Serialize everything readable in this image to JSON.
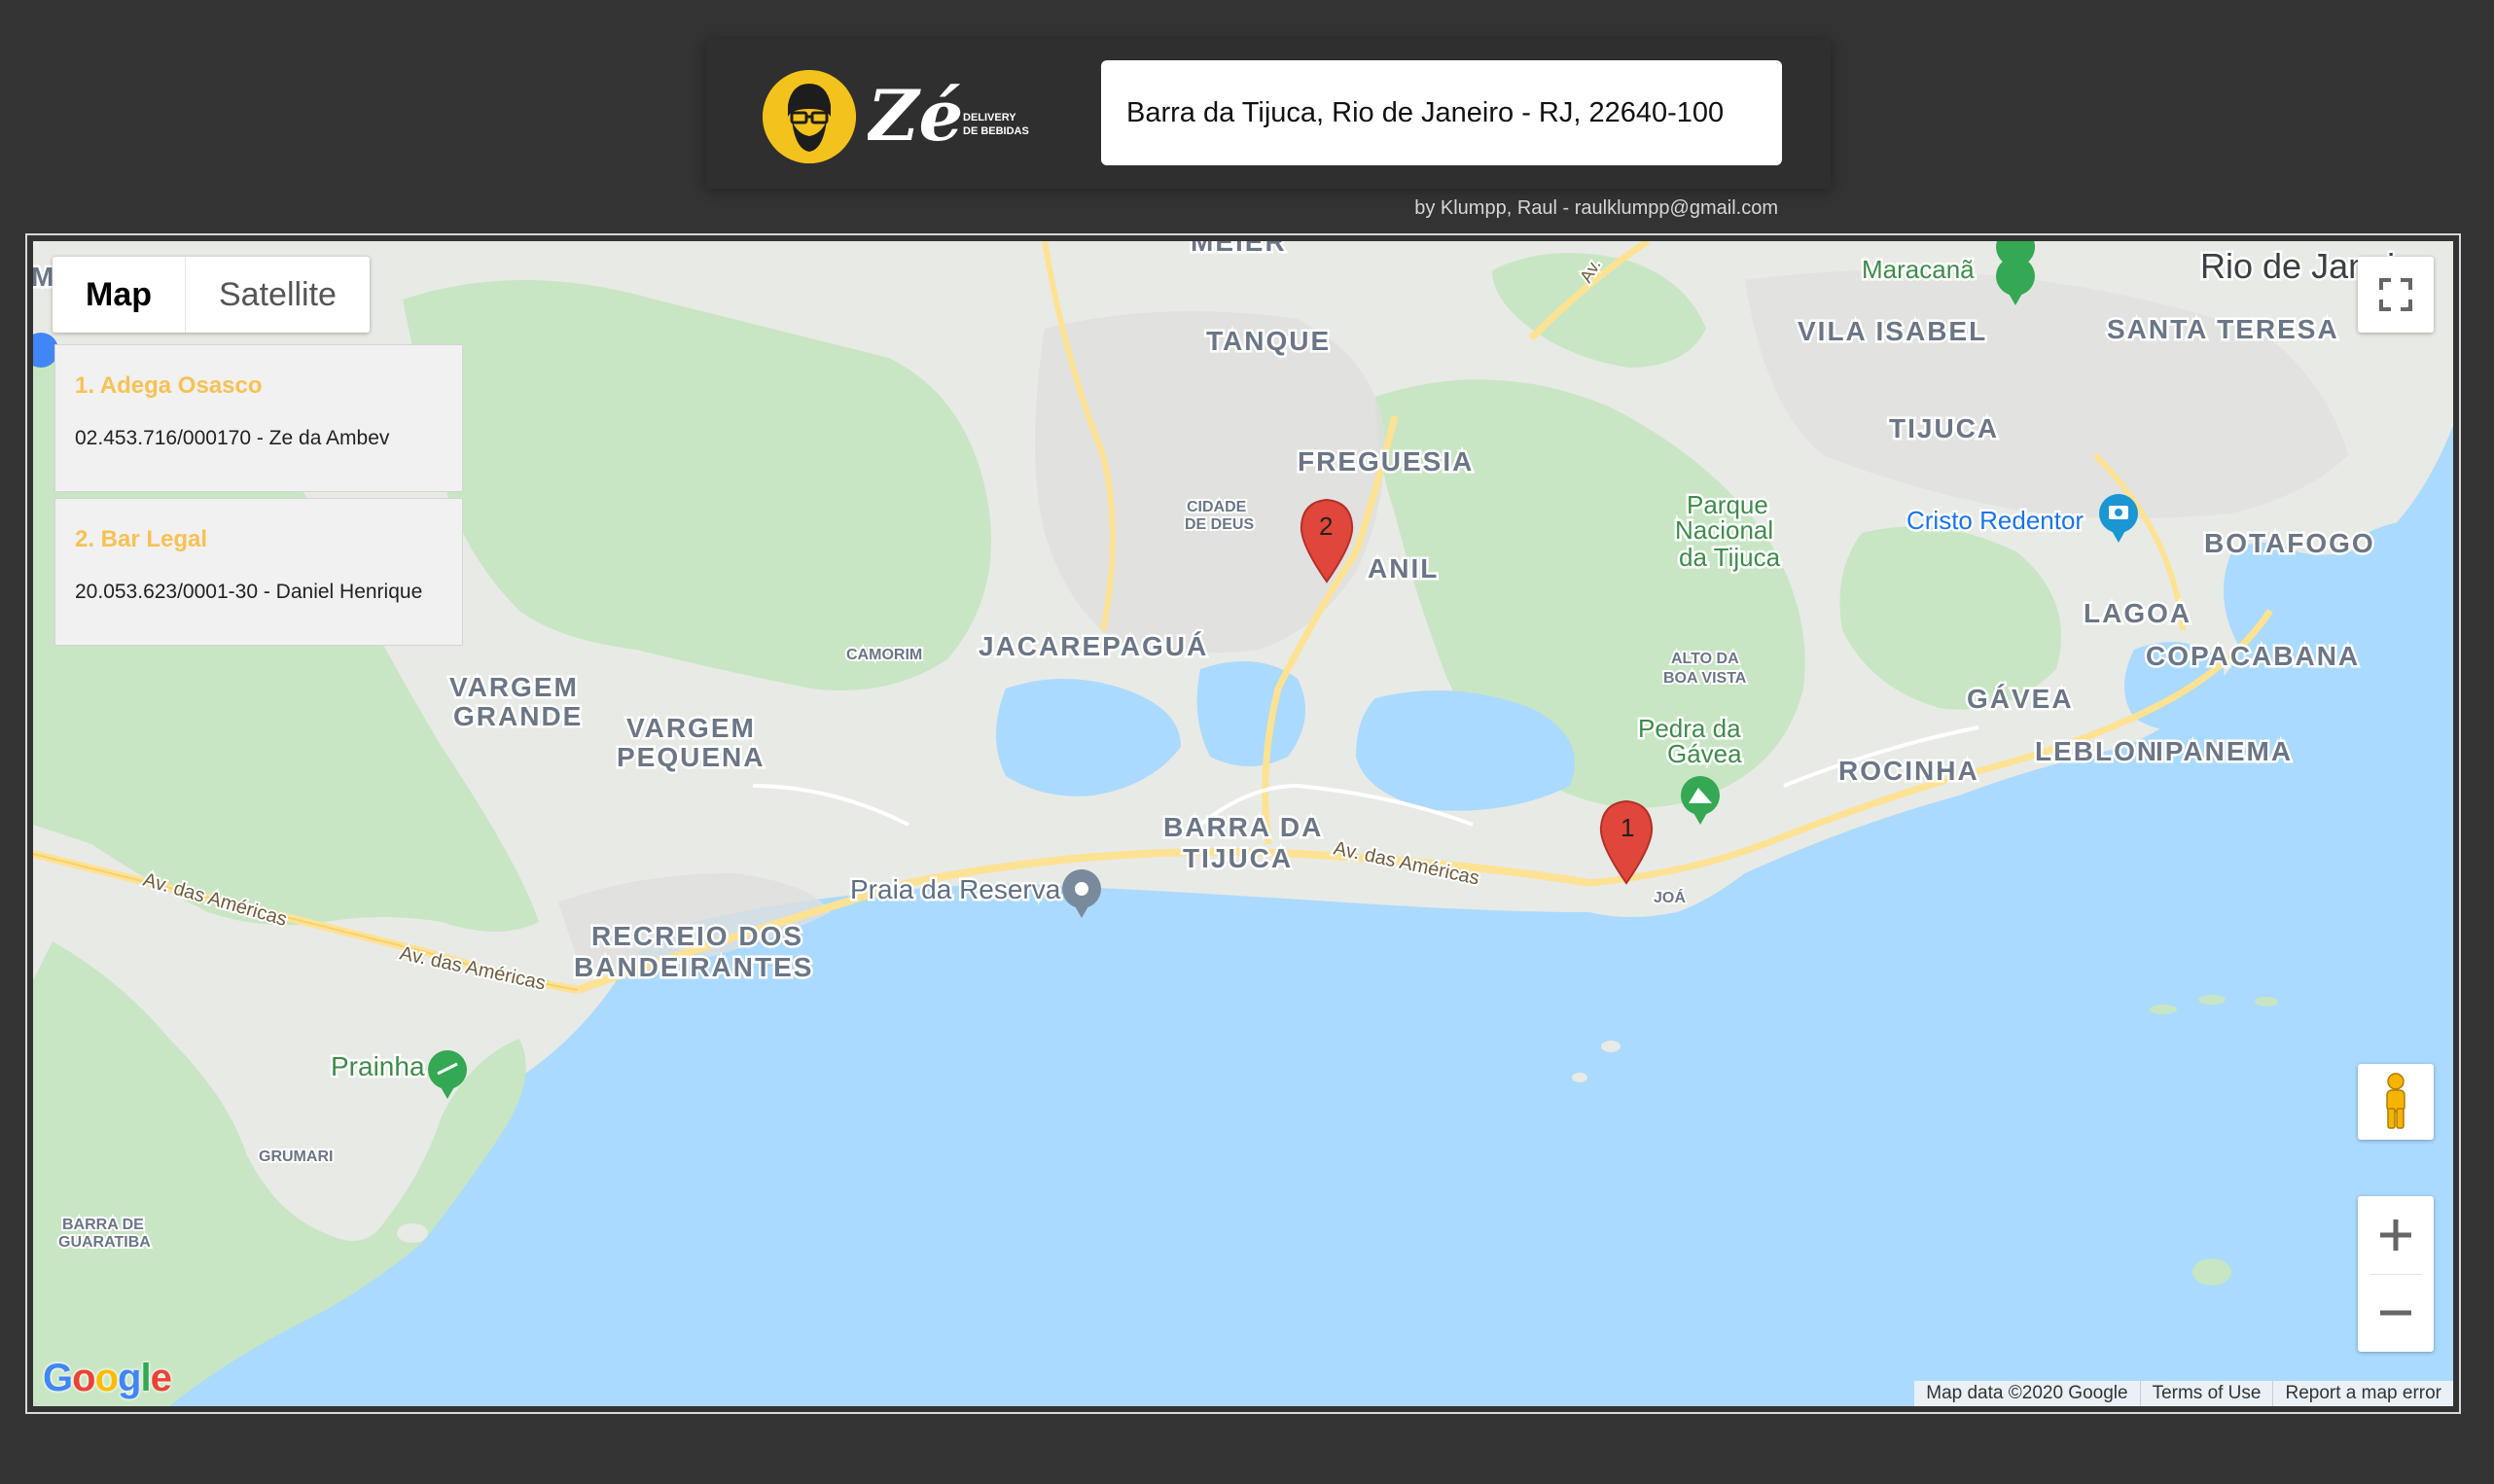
{
  "header": {
    "logo_text": "Zé",
    "logo_tagline_1": "DELIVERY",
    "logo_tagline_2": "DE BEBIDAS",
    "address_value": "Barra da Tijuca, Rio de Janeiro - RJ, 22640-100",
    "credit": "by Klumpp, Raul - raulklumpp@gmail.com"
  },
  "map": {
    "type_tabs": [
      {
        "label": "Map",
        "active": true
      },
      {
        "label": "Satellite",
        "active": false
      }
    ],
    "stores": [
      {
        "name": "1. Adega Osasco",
        "info": "02.453.716/000170 - Ze da Ambev"
      },
      {
        "name": "2. Bar Legal",
        "info": "20.053.623/0001-30 - Daniel Henrique"
      }
    ],
    "markers": [
      {
        "label": "1"
      },
      {
        "label": "2"
      }
    ],
    "places": {
      "meier": "MEIER",
      "rio": "Rio de Janeiro",
      "maracana": "Maracanã",
      "tanque": "TANQUE",
      "vila_isabel": "VILA ISABEL",
      "santa_teresa": "SANTA TERESA",
      "tijuca": "TIJUCA",
      "freguesia": "FREGUESIA",
      "cidade_de_deus_1": "CIDADE",
      "cidade_de_deus_2": "DE DEUS",
      "anil": "ANIL",
      "parque_1": "Parque",
      "parque_2": "Nacional",
      "parque_3": "da Tijuca",
      "cristo": "Cristo Redentor",
      "botafogo": "BOTAFOGO",
      "lagoa": "LAGOA",
      "copacabana": "COPACABANA",
      "jacarepagua": "JACAREPAGUÁ",
      "camorim": "CAMORIM",
      "alto_boa_vista_1": "ALTO DA",
      "alto_boa_vista_2": "BOA VISTA",
      "gavea": "GÁVEA",
      "vargem_grande_1": "VARGEM",
      "vargem_grande_2": "GRANDE",
      "vargem_pequena_1": "VARGEM",
      "vargem_pequena_2": "PEQUENA",
      "pedra_gavea_1": "Pedra da",
      "pedra_gavea_2": "Gávea",
      "rocinha": "ROCINHA",
      "leblon": "LEBLON",
      "ipanema": "IPANEMA",
      "barra_1": "BARRA DA",
      "barra_2": "TIJUCA",
      "av_americas_1": "Av. das Américas",
      "av_americas_2": "Av. das Américas",
      "av_americas_3": "Av. das Américas",
      "av_short": "Av.",
      "joa": "JOÁ",
      "praia_reserva": "Praia da Reserva",
      "recreio_1": "RECREIO DOS",
      "recreio_2": "BANDEIRANTES",
      "prainha": "Prainha",
      "grumari": "GRUMARI",
      "barra_guaratiba_1": "BARRA DE",
      "barra_guaratiba_2": "GUARATIBA",
      "m_edge": "M"
    },
    "attribution": {
      "map_data": "Map data ©2020 Google",
      "terms": "Terms of Use",
      "report": "Report a map error"
    },
    "google_logo": [
      "G",
      "o",
      "o",
      "g",
      "l",
      "e"
    ],
    "icons": {
      "fullscreen": "fullscreen-icon",
      "pegman": "pegman-icon",
      "zoom_in": "zoom-in-icon",
      "zoom_out": "zoom-out-icon"
    },
    "colors": {
      "water": "#aadaff",
      "land": "#e8eae5",
      "park": "#c8e6c3",
      "marker": "#e0463a",
      "store_name": "#f7c153",
      "logo_yellow": "#f4c21c"
    }
  }
}
